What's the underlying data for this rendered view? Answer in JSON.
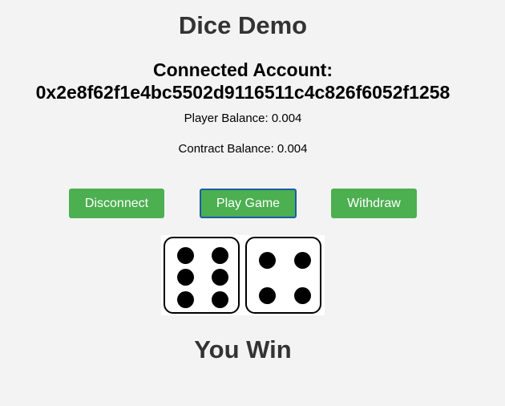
{
  "app": {
    "title": "Dice Demo"
  },
  "account": {
    "label": "Connected Account:",
    "address": "0x2e8f62f1e4bc5502d9116511c4c826f6052f1258"
  },
  "balances": {
    "player": "Player Balance: 0.004",
    "contract": "Contract Balance: 0.004"
  },
  "buttons": {
    "disconnect": "Disconnect",
    "play": "Play Game",
    "withdraw": "Withdraw"
  },
  "dice": {
    "die1_value": 6,
    "die2_value": 4
  },
  "result": {
    "text": "You Win"
  },
  "colors": {
    "button_bg": "#4caf50",
    "button_text": "#ffffff",
    "focus_border": "#1a5ca8",
    "heading": "#333333"
  }
}
